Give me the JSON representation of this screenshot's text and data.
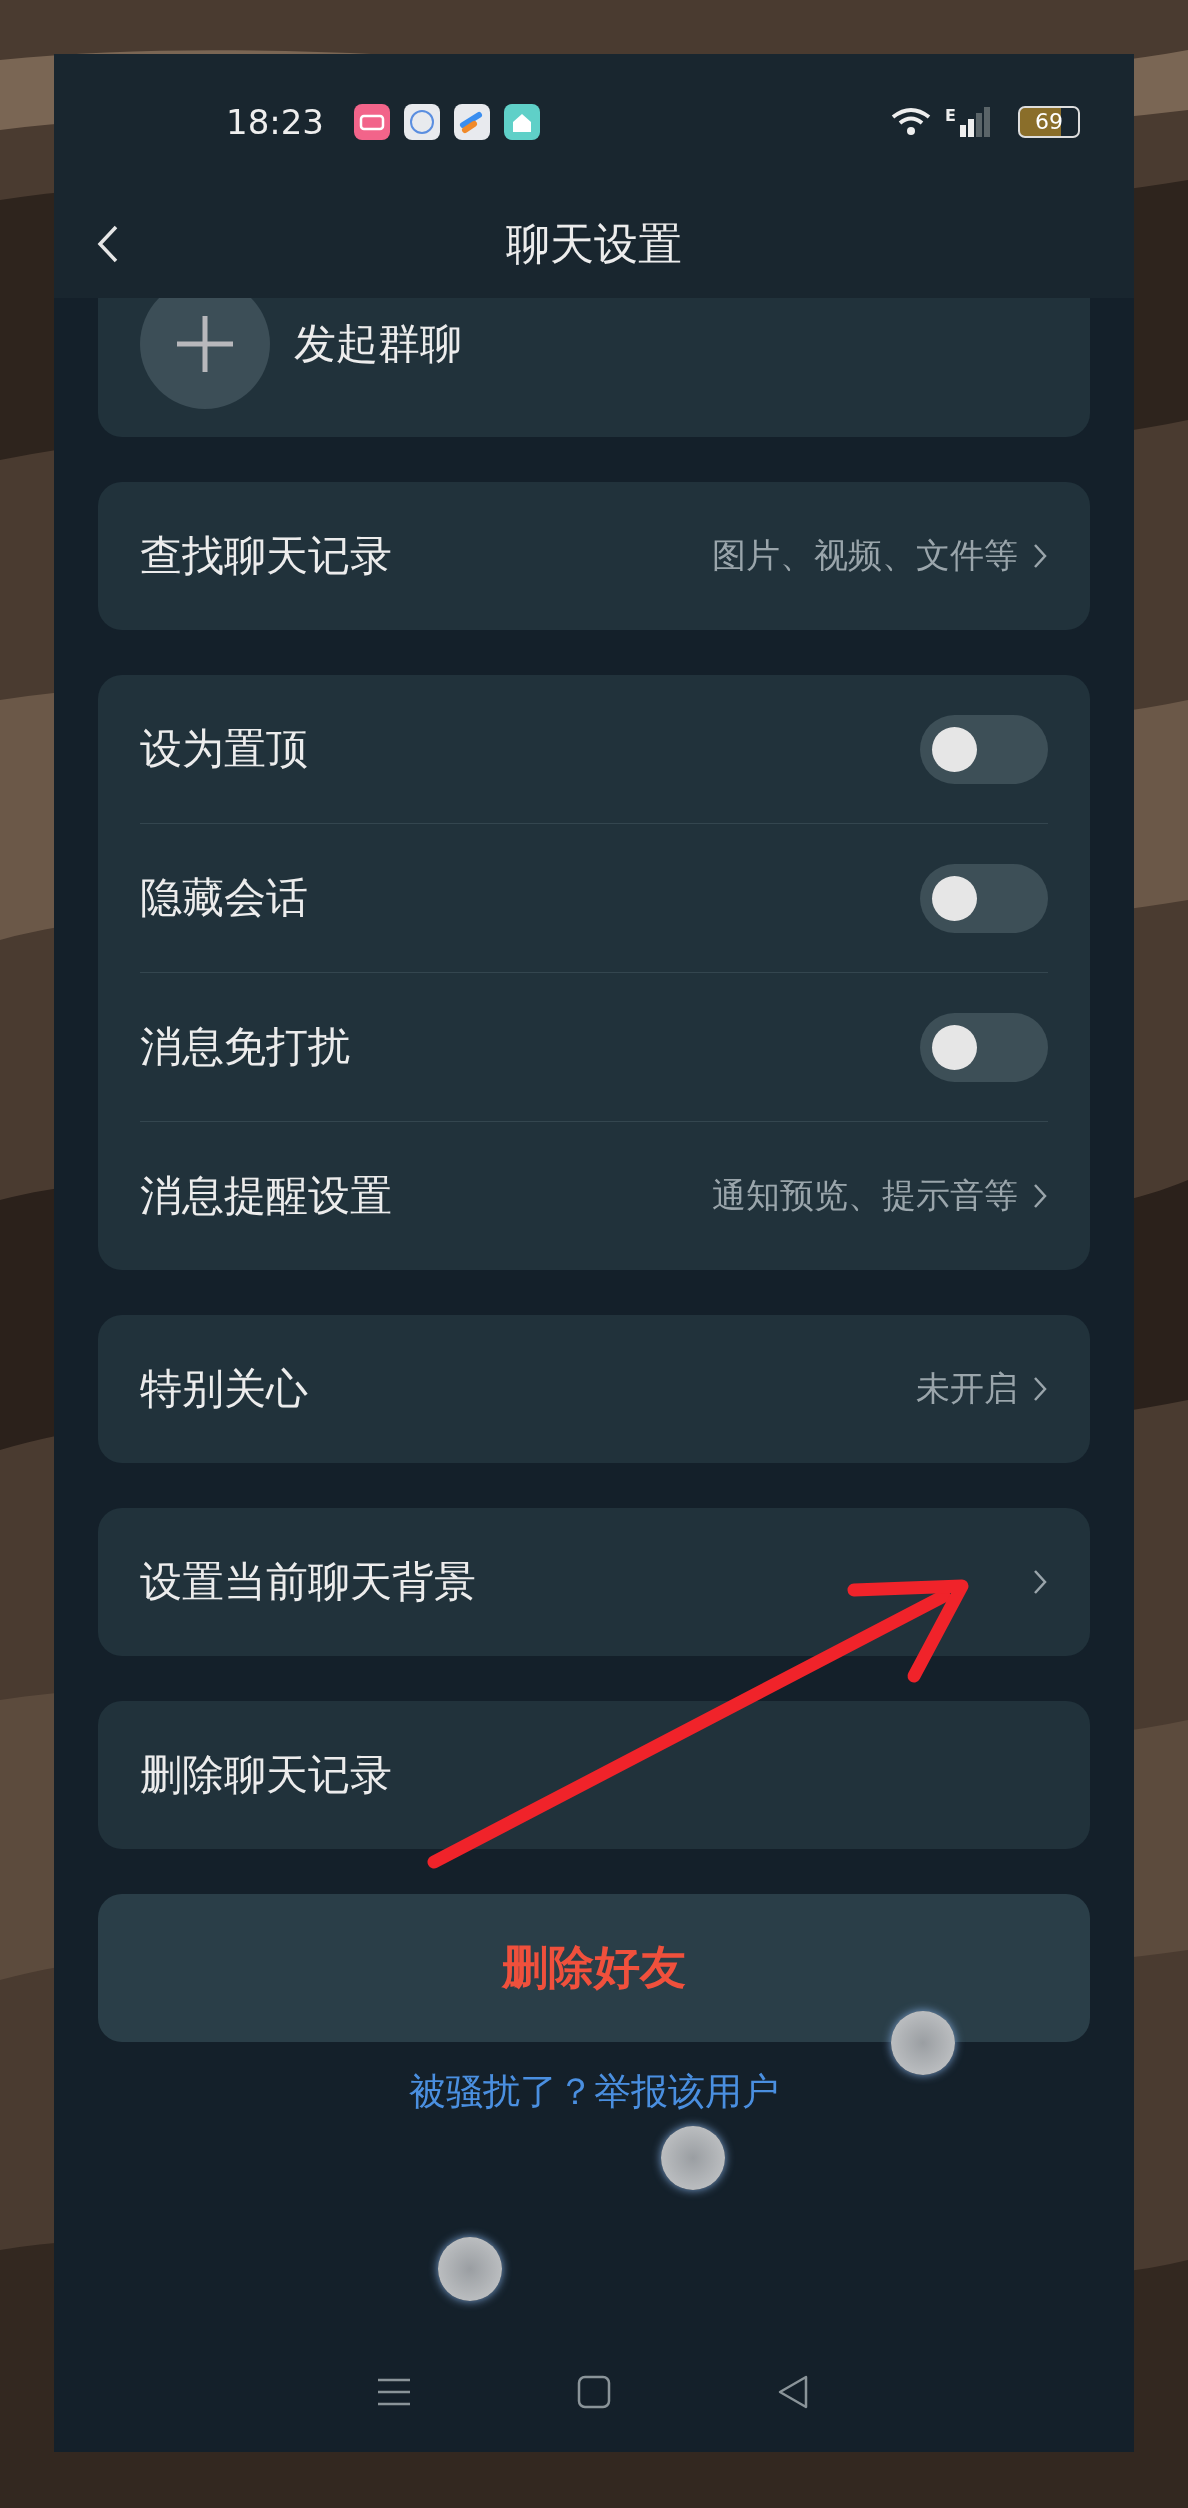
{
  "status_bar": {
    "time": "18:23",
    "network": "E",
    "battery": "69"
  },
  "header": {
    "title": "聊天设置"
  },
  "group_chat": {
    "label": "发起群聊"
  },
  "groups": [
    {
      "rows": [
        {
          "kind": "link",
          "label": "查找聊天记录",
          "value": "图片、视频、文件等"
        }
      ]
    },
    {
      "rows": [
        {
          "kind": "toggle",
          "label": "设为置顶",
          "on": false
        },
        {
          "kind": "toggle",
          "label": "隐藏会话",
          "on": false
        },
        {
          "kind": "toggle",
          "label": "消息免打扰",
          "on": false
        },
        {
          "kind": "link",
          "label": "消息提醒设置",
          "value": "通知预览、提示音等"
        }
      ]
    },
    {
      "rows": [
        {
          "kind": "link",
          "label": "特别关心",
          "value": "未开启"
        }
      ]
    },
    {
      "rows": [
        {
          "kind": "link",
          "label": "设置当前聊天背景"
        }
      ]
    },
    {
      "rows": [
        {
          "kind": "plain",
          "label": "删除聊天记录"
        }
      ]
    }
  ],
  "delete_button": "删除好友",
  "report_link": "被骚扰了？举报该用户"
}
